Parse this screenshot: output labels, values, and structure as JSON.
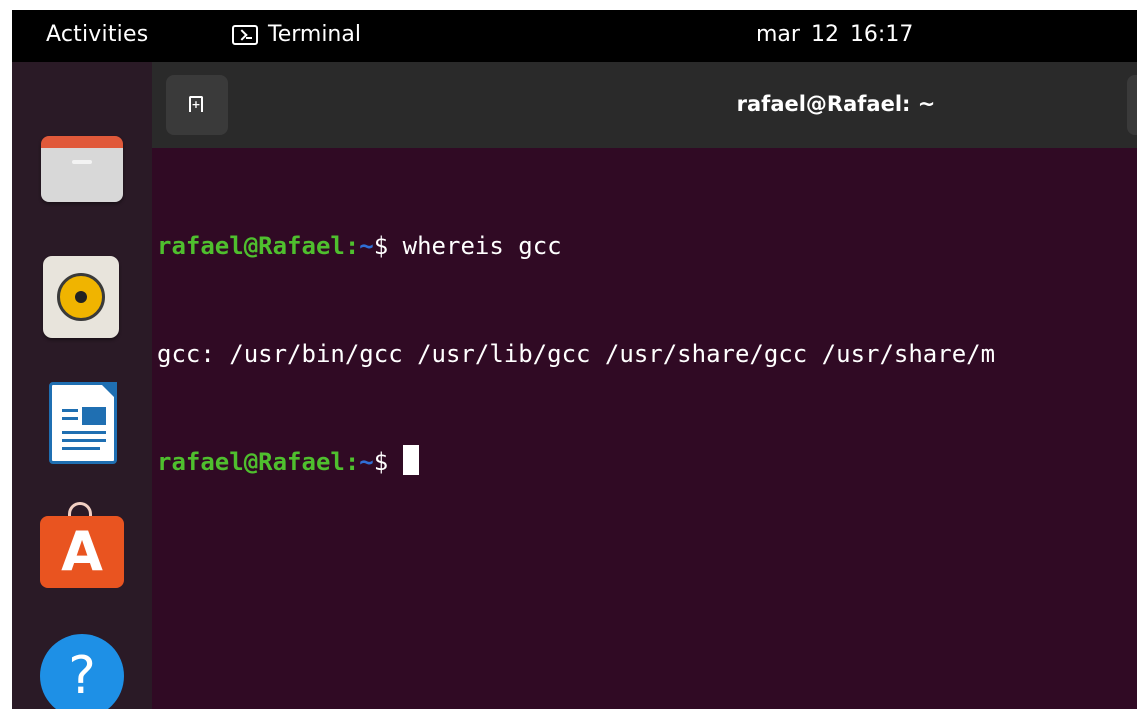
{
  "topbar": {
    "activities": "Activities",
    "app_name": "Terminal",
    "clock": "mar 12  16:17"
  },
  "dock": {
    "items": [
      {
        "icon": "files-icon"
      },
      {
        "icon": "rhythmbox-icon"
      },
      {
        "icon": "libreoffice-writer-icon"
      },
      {
        "icon": "app-center-icon",
        "glyph": "A"
      },
      {
        "icon": "help-icon",
        "glyph": "?"
      }
    ]
  },
  "terminal": {
    "title": "rafael@Rafael: ~",
    "lines": [
      {
        "user": "rafael@Rafael",
        "colon": ":",
        "path": "~",
        "symbol": "$",
        "command": " whereis gcc"
      },
      {
        "output": "gcc: /usr/bin/gcc /usr/lib/gcc /usr/share/gcc /usr/share/m"
      },
      {
        "user": "rafael@Rafael",
        "colon": ":",
        "path": "~",
        "symbol": "$",
        "command": " "
      }
    ]
  },
  "colors": {
    "topbar_bg": "#000000",
    "dock_bg": "#2a1a26",
    "terminal_bg": "#300a24",
    "header_bg": "#2a2a2a",
    "prompt_user": "#4fbf2e",
    "prompt_path": "#2f6fd6"
  }
}
